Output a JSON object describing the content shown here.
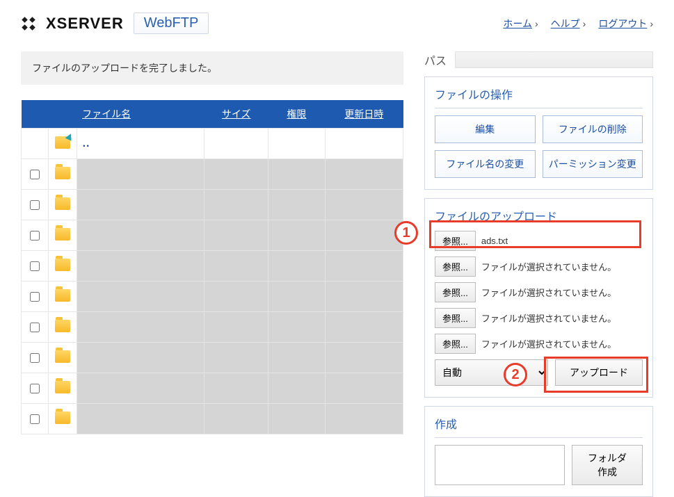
{
  "brand": {
    "name": "XSERVER",
    "product": "WebFTP"
  },
  "top_links": {
    "home": "ホーム",
    "help": "ヘルプ",
    "logout": "ログアウト"
  },
  "notice": "ファイルのアップロードを完了しました。",
  "table": {
    "headers": {
      "name": "ファイル名",
      "size": "サイズ",
      "perm": "権限",
      "date": "更新日時"
    },
    "up_label": "..",
    "row_count": 9
  },
  "path": {
    "label": "パス",
    "value": ""
  },
  "ops": {
    "title": "ファイルの操作",
    "edit": "編集",
    "delete": "ファイルの削除",
    "rename": "ファイル名の変更",
    "chmod": "パーミッション変更"
  },
  "upload": {
    "title": "ファイルのアップロード",
    "browse": "参照...",
    "rows": [
      "ads.txt",
      "ファイルが選択されていません。",
      "ファイルが選択されていません。",
      "ファイルが選択されていません。",
      "ファイルが選択されていません。"
    ],
    "mode_selected": "自動",
    "submit": "アップロード"
  },
  "create": {
    "title": "作成",
    "mkdir": "フォルダ作成",
    "value": ""
  },
  "annot": {
    "one": "1",
    "two": "2"
  }
}
